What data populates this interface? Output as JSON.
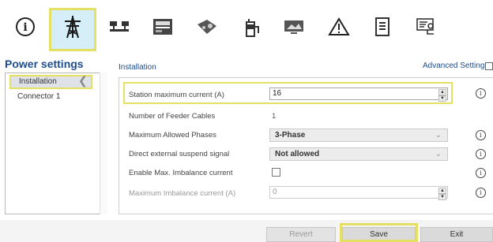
{
  "toolbar": {
    "icons": [
      {
        "name": "info-icon",
        "selected": false
      },
      {
        "name": "power-pylon-icon",
        "selected": true
      },
      {
        "name": "network-icon",
        "selected": false
      },
      {
        "name": "payment-terminal-icon",
        "selected": false
      },
      {
        "name": "charging-cable-icon",
        "selected": false
      },
      {
        "name": "charger-icon",
        "selected": false
      },
      {
        "name": "display-icon",
        "selected": false
      },
      {
        "name": "warning-icon",
        "selected": false
      },
      {
        "name": "document-icon",
        "selected": false
      },
      {
        "name": "diagnostics-icon",
        "selected": false
      }
    ],
    "highlight_color": "#e3e064"
  },
  "sidebar": {
    "title": "Power settings",
    "items": [
      {
        "label": "Installation",
        "selected": true
      },
      {
        "label": "Connector 1",
        "selected": false
      }
    ]
  },
  "main": {
    "section_title": "Installation",
    "advanced_settings_label": "Advanced Settings",
    "advanced_settings_checked": false,
    "rows": [
      {
        "label": "Station maximum current (A)",
        "value": "16"
      },
      {
        "label": "Number of Feeder Cables",
        "value": "1"
      },
      {
        "label": "Maximum Allowed Phases",
        "value": "3-Phase"
      },
      {
        "label": "Direct external suspend signal",
        "value": "Not allowed"
      },
      {
        "label": "Enable Max. Imbalance current",
        "checked": false
      },
      {
        "label": "Maximum Imbalance current (A)",
        "value": "0"
      }
    ],
    "info_symbol": "i"
  },
  "footer": {
    "revert_label": "Revert",
    "save_label": "Save",
    "exit_label": "Exit"
  },
  "colors": {
    "accent_title": "#1e4d8c",
    "highlight": "#e3e064",
    "selected_tab_bg": "#d6eef8"
  }
}
